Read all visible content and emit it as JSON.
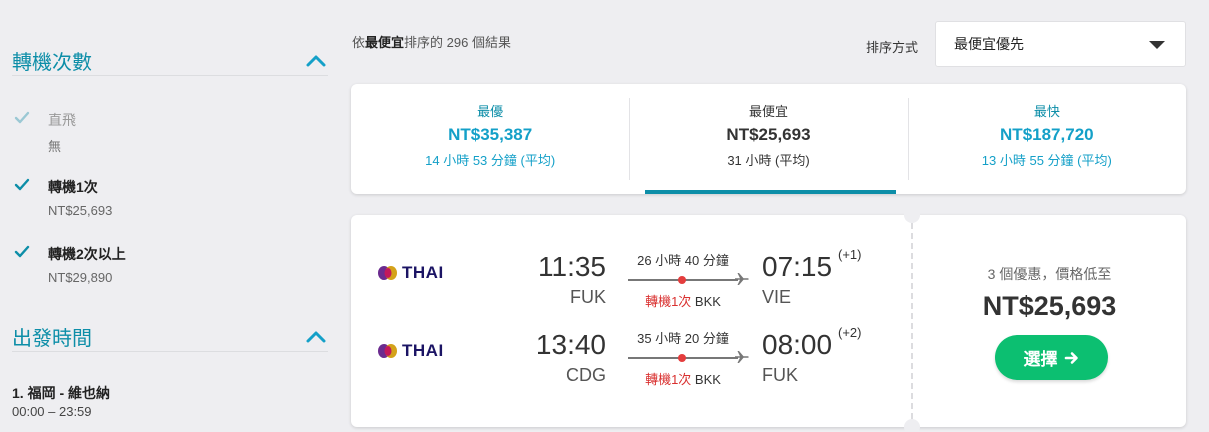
{
  "sidebar": {
    "stops_section": {
      "title": "轉機次數",
      "items": [
        {
          "label": "直飛",
          "sub": "無",
          "checked": true,
          "disabled": true
        },
        {
          "label": "轉機1次",
          "sub": "NT$25,693",
          "checked": true,
          "disabled": false
        },
        {
          "label": "轉機2次以上",
          "sub": "NT$29,890",
          "checked": true,
          "disabled": false
        }
      ]
    },
    "departure_section": {
      "title": "出發時間",
      "route": "1. 福岡 - 維也納",
      "time_range": "00:00 – 23:59"
    }
  },
  "results": {
    "prefix": "依",
    "emphasis": "最便宜",
    "suffix": "排序的 296 個結果"
  },
  "sort": {
    "label": "排序方式",
    "selected": "最便宜優先"
  },
  "tabs": [
    {
      "name": "最優",
      "price": "NT$35,387",
      "duration": "14 小時 53 分鐘 (平均)",
      "active": false
    },
    {
      "name": "最便宜",
      "price": "NT$25,693",
      "duration": "31 小時 (平均)",
      "active": true
    },
    {
      "name": "最快",
      "price": "NT$187,720",
      "duration": "13 小時 55 分鐘 (平均)",
      "active": false
    }
  ],
  "result": {
    "legs": [
      {
        "airline": "THAI",
        "dep_time": "11:35",
        "dep_code": "FUK",
        "arr_time": "07:15",
        "arr_code": "VIE",
        "day_offset": "(+1)",
        "duration": "26 小時 40 分鐘",
        "stops_label": "轉機1次",
        "via": "BKK"
      },
      {
        "airline": "THAI",
        "dep_time": "13:40",
        "dep_code": "CDG",
        "arr_time": "08:00",
        "arr_code": "FUK",
        "day_offset": "(+2)",
        "duration": "35 小時 20 分鐘",
        "stops_label": "轉機1次",
        "via": "BKK"
      }
    ],
    "deal_count": "3 個優惠，價格低至",
    "price": "NT$25,693",
    "select_label": "選擇"
  },
  "colors": {
    "accent": "#0d8ea8",
    "link": "#14a0c8",
    "select_button": "#0cbf71",
    "stop_red": "#d9302f"
  }
}
